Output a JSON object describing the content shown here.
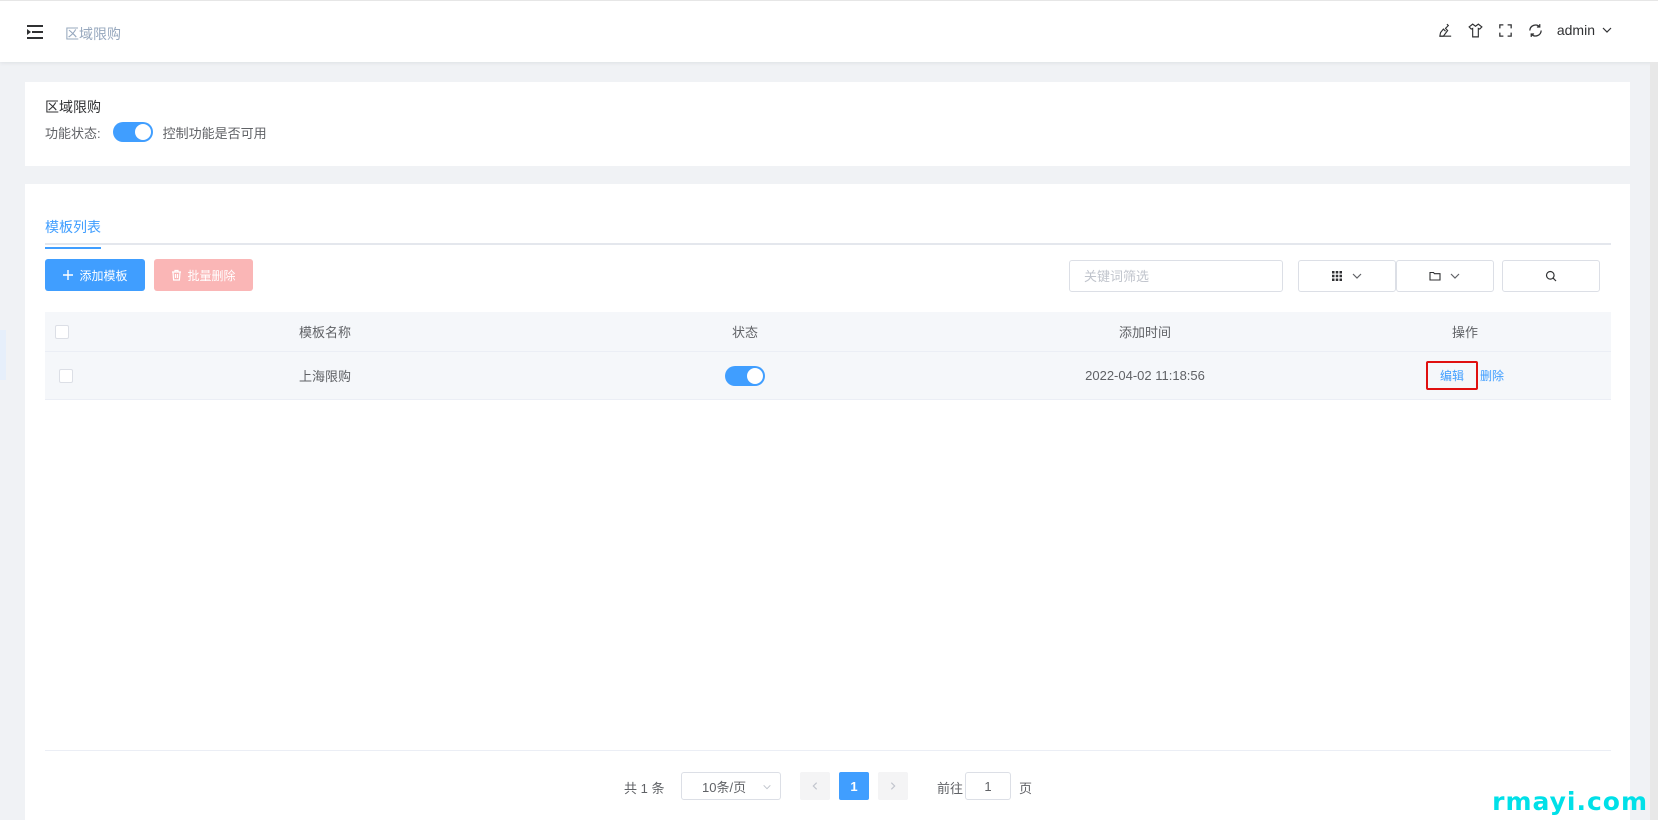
{
  "header": {
    "breadcrumb": "区域限购",
    "user_name": "admin",
    "icons": [
      "hamburger-icon",
      "clean-icon",
      "shirt-icon",
      "fullscreen-icon",
      "refresh-icon",
      "chevron-down-icon"
    ]
  },
  "feature_card": {
    "title": "区域限购",
    "status_label": "功能状态:",
    "switch_on": true,
    "hint": "控制功能是否可用"
  },
  "tabs": [
    {
      "label": "模板列表",
      "active": true
    }
  ],
  "toolbar": {
    "add_label": "添加模板",
    "batch_delete_label": "批量删除",
    "search_placeholder": "关键词筛选"
  },
  "table": {
    "columns": [
      "模板名称",
      "状态",
      "添加时间",
      "操作"
    ],
    "rows": [
      {
        "name": "上海限购",
        "status_on": true,
        "time": "2022-04-02 11:18:56",
        "edit": "编辑",
        "delete": "删除"
      }
    ]
  },
  "pagination": {
    "total": "共 1 条",
    "page_size": "10条/页",
    "current": "1",
    "goto_label": "前往",
    "goto_value": "1",
    "page_label": "页"
  },
  "watermark": "rmayi.com",
  "colors": {
    "primary": "#409eff",
    "danger_disabled": "#fab6b6",
    "highlight": "#e01010"
  }
}
